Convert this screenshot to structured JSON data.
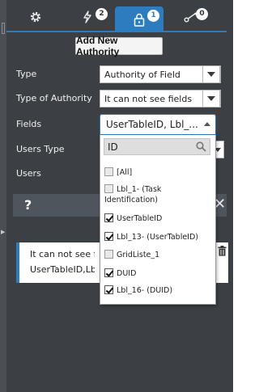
{
  "tabs": [
    {
      "name": "settings",
      "icon": "gear-icon",
      "badge": ""
    },
    {
      "name": "actions",
      "icon": "lightning-icon",
      "badge": "2"
    },
    {
      "name": "authorities",
      "icon": "lock-icon",
      "badge": "1"
    },
    {
      "name": "connections",
      "icon": "link-icon",
      "badge": "0"
    }
  ],
  "header": {
    "add_button": "Add New Authority"
  },
  "form": {
    "type_label": "Type",
    "type_value": "Authority of Field",
    "type_of_authority_label": "Type of Authority",
    "type_of_authority_value": "It can not see fields",
    "fields_label": "Fields",
    "fields_value": "UserTableID, Lbl_...",
    "users_type_label": "Users Type",
    "users_label": "Users"
  },
  "help_bar": {
    "question_mark": "?",
    "close": "✕"
  },
  "card": {
    "line1": "It can not see fields",
    "line2": "UserTableID,Lbl_13-,DUID"
  },
  "dropdown": {
    "search_value": "ID",
    "options": [
      {
        "label": "[All]",
        "checked": false
      },
      {
        "label": "Lbl_1- (Task Identification)",
        "checked": false
      },
      {
        "label": "UserTableID",
        "checked": true
      },
      {
        "label": "Lbl_13- (UserTableID)",
        "checked": true
      },
      {
        "label": "GridListe_1",
        "checked": false
      },
      {
        "label": "DUID",
        "checked": true
      },
      {
        "label": "Lbl_16- (DUID)",
        "checked": true
      }
    ]
  },
  "colors": {
    "accent": "#2c7cbf",
    "panel": "#3c4045",
    "help_bar": "#4f555c"
  }
}
